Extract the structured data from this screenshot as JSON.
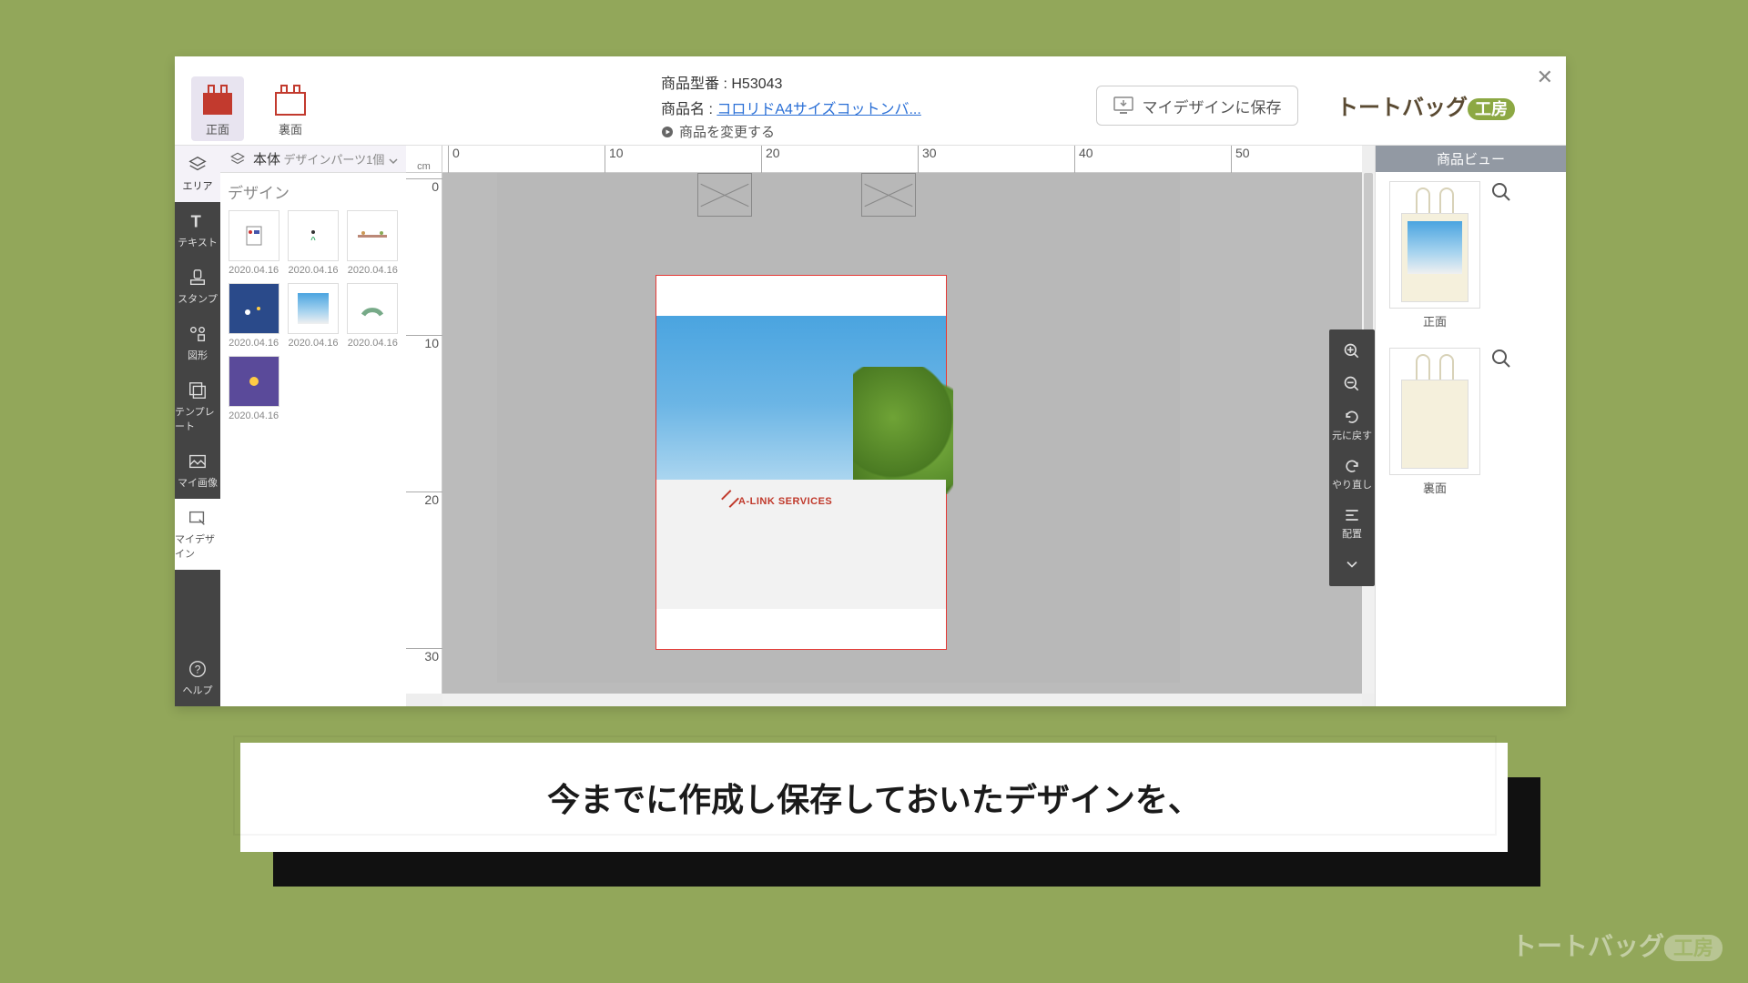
{
  "header": {
    "view_front": "正面",
    "view_back": "裏面",
    "product_code_label": "商品型番 :",
    "product_code": "H53043",
    "product_name_label": "商品名 :",
    "product_name": "コロリドA4サイズコットンバ...",
    "change_product": "商品を変更する",
    "save_button": "マイデザインに保存",
    "logo_text": "トートバッグ",
    "logo_accent": "工房"
  },
  "sidebar": {
    "area": "エリア",
    "text": "テキスト",
    "stamp": "スタンプ",
    "shape": "図形",
    "template": "テンプレート",
    "myimage": "マイ画像",
    "mydesign": "マイデザイン",
    "help": "ヘルプ"
  },
  "area_header": {
    "title": "本体",
    "parts": "デザインパーツ1個"
  },
  "design_panel": {
    "title": "デザイン",
    "dates": [
      "2020.04.16",
      "2020.04.16",
      "2020.04.16",
      "2020.04.16",
      "2020.04.16",
      "2020.04.16",
      "2020.04.16"
    ]
  },
  "ruler": {
    "unit": "cm",
    "h": [
      "0",
      "10",
      "20",
      "30",
      "40",
      "50"
    ],
    "v": [
      "0",
      "10",
      "20",
      "30"
    ]
  },
  "canvas": {
    "building_text": "A-LINK SERVICES"
  },
  "tools": {
    "undo": "元に戻す",
    "redo": "やり直し",
    "align": "配置"
  },
  "right_panel": {
    "title": "商品ビュー",
    "front": "正面",
    "back": "裏面"
  },
  "caption": "今までに作成し保存しておいたデザインを、",
  "watermark": {
    "text": "トートバッグ",
    "accent": "工房"
  }
}
